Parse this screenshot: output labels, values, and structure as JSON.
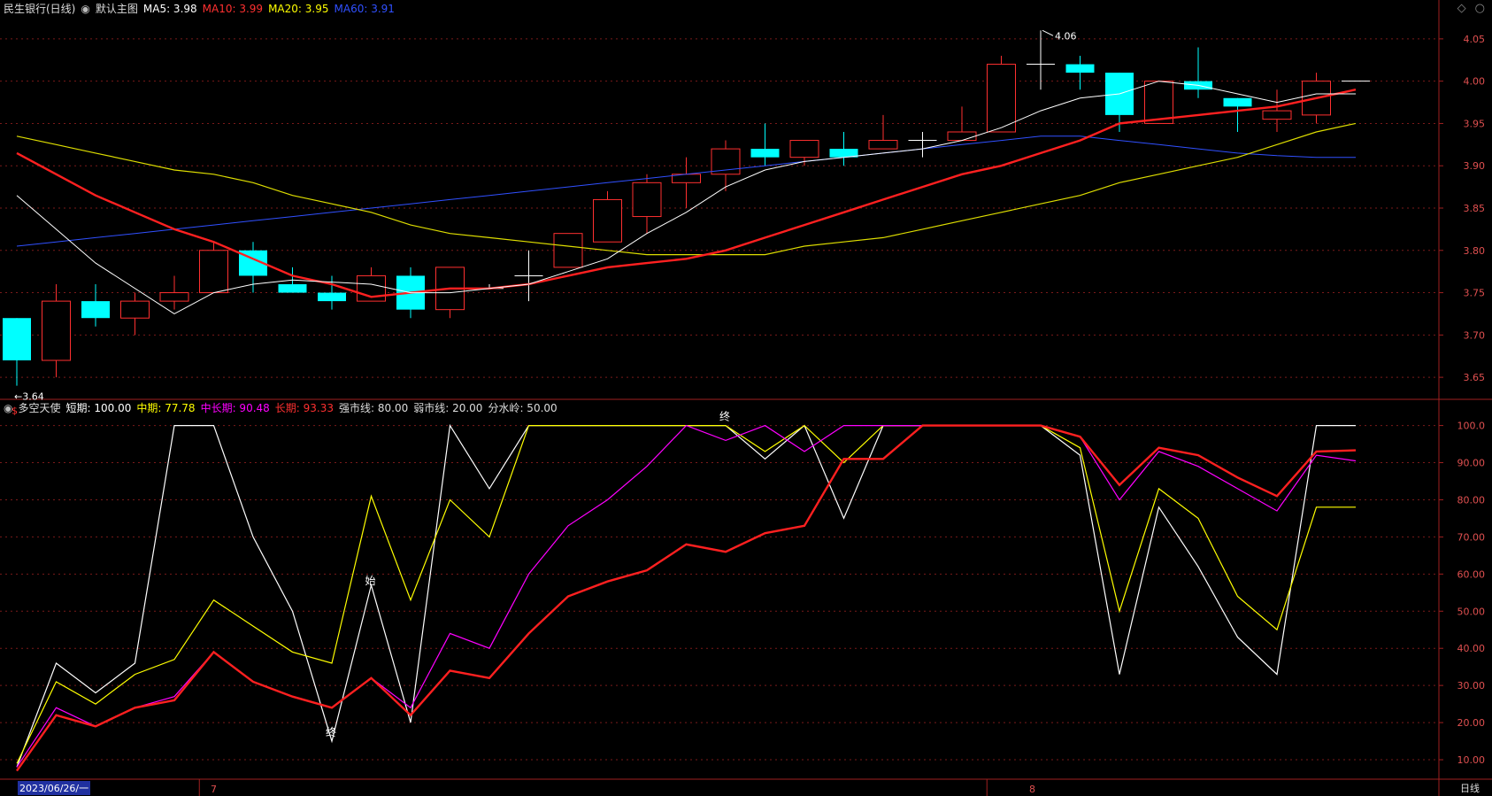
{
  "header": {
    "stock": "民生银行(日线)",
    "template": "默认主图",
    "ma": [
      {
        "label": "MA5: 3.98",
        "color": "#ffffff"
      },
      {
        "label": "MA10: 3.99",
        "color": "#ff3030"
      },
      {
        "label": "MA20: 3.95",
        "color": "#ffff00"
      },
      {
        "label": "MA60: 3.91",
        "color": "#3050ff"
      }
    ]
  },
  "indicator": {
    "name": "多空天使",
    "items": [
      {
        "label": "短期: 100.00",
        "color": "#ffffff"
      },
      {
        "label": "中期: 77.78",
        "color": "#ffff00"
      },
      {
        "label": "中长期: 90.48",
        "color": "#ff00ff"
      },
      {
        "label": "长期: 93.33",
        "color": "#ff3030"
      },
      {
        "label": "强市线: 80.00",
        "color": "#dddddd"
      },
      {
        "label": "弱市线: 20.00",
        "color": "#dddddd"
      },
      {
        "label": "分水岭: 50.00",
        "color": "#dddddd"
      }
    ]
  },
  "footer": {
    "dates": [
      "2023/06/26/一",
      "7",
      "8"
    ],
    "period": "日线"
  },
  "chart_data": [
    {
      "type": "candlestick",
      "title": "民生银行(日线)",
      "ylim": [
        3.625,
        4.075
      ],
      "yticks": [
        "4.05",
        "4.00",
        "3.95",
        "3.90",
        "3.85",
        "3.80",
        "3.75",
        "3.70",
        "3.65"
      ],
      "ohlc": [
        [
          3.72,
          3.72,
          3.64,
          3.67
        ],
        [
          3.67,
          3.76,
          3.65,
          3.74
        ],
        [
          3.74,
          3.76,
          3.71,
          3.72
        ],
        [
          3.72,
          3.75,
          3.7,
          3.74
        ],
        [
          3.74,
          3.77,
          3.73,
          3.75
        ],
        [
          3.75,
          3.81,
          3.75,
          3.8
        ],
        [
          3.8,
          3.81,
          3.75,
          3.77
        ],
        [
          3.76,
          3.78,
          3.75,
          3.75
        ],
        [
          3.75,
          3.77,
          3.73,
          3.74
        ],
        [
          3.74,
          3.78,
          3.74,
          3.77
        ],
        [
          3.77,
          3.78,
          3.72,
          3.73
        ],
        [
          3.73,
          3.78,
          3.72,
          3.78
        ],
        [
          3.755,
          3.76,
          3.755,
          3.755
        ],
        [
          3.77,
          3.8,
          3.74,
          3.77
        ],
        [
          3.78,
          3.82,
          3.78,
          3.82
        ],
        [
          3.81,
          3.87,
          3.81,
          3.86
        ],
        [
          3.84,
          3.89,
          3.82,
          3.88
        ],
        [
          3.88,
          3.91,
          3.85,
          3.89
        ],
        [
          3.89,
          3.93,
          3.87,
          3.92
        ],
        [
          3.92,
          3.95,
          3.9,
          3.91
        ],
        [
          3.91,
          3.93,
          3.9,
          3.93
        ],
        [
          3.92,
          3.94,
          3.9,
          3.91
        ],
        [
          3.92,
          3.96,
          3.92,
          3.93
        ],
        [
          3.93,
          3.94,
          3.91,
          3.93
        ],
        [
          3.93,
          3.97,
          3.93,
          3.94
        ],
        [
          3.94,
          4.03,
          3.94,
          4.02
        ],
        [
          4.02,
          4.06,
          3.99,
          4.02
        ],
        [
          4.02,
          4.03,
          3.99,
          4.01
        ],
        [
          4.01,
          4.01,
          3.94,
          3.96
        ],
        [
          3.95,
          4.0,
          3.95,
          4.0
        ],
        [
          4.0,
          4.04,
          3.98,
          3.99
        ],
        [
          3.98,
          3.98,
          3.94,
          3.97
        ],
        [
          3.955,
          3.99,
          3.94,
          3.965
        ],
        [
          3.96,
          4.01,
          3.95,
          4.0
        ],
        [
          4.0,
          4.0,
          4.0,
          4.0
        ]
      ],
      "ma5": [
        3.865,
        null,
        3.785,
        null,
        3.725,
        3.75,
        3.76,
        3.765,
        null,
        3.76,
        3.75,
        3.75,
        3.755,
        3.76,
        3.775,
        3.79,
        3.82,
        3.845,
        3.875,
        3.895,
        3.905,
        3.91,
        3.915,
        3.92,
        3.93,
        3.945,
        3.965,
        3.98,
        3.985,
        4.0,
        3.995,
        3.985,
        3.975,
        3.985,
        3.985
      ],
      "ma10": [
        3.915,
        3.89,
        3.865,
        3.845,
        3.825,
        3.81,
        3.79,
        3.77,
        3.76,
        3.745,
        3.75,
        3.755,
        3.755,
        3.76,
        3.77,
        3.78,
        3.785,
        3.79,
        3.8,
        3.815,
        3.83,
        3.845,
        3.86,
        3.875,
        3.89,
        3.9,
        3.915,
        3.93,
        3.95,
        3.955,
        3.96,
        3.965,
        3.97,
        3.98,
        3.99
      ],
      "ma20": [
        3.935,
        3.925,
        3.915,
        3.905,
        3.895,
        3.89,
        3.88,
        3.865,
        3.855,
        3.845,
        3.83,
        3.82,
        3.815,
        3.81,
        3.805,
        3.8,
        3.795,
        3.795,
        3.795,
        3.795,
        3.805,
        3.81,
        3.815,
        3.825,
        3.835,
        3.845,
        3.855,
        3.865,
        3.88,
        3.89,
        3.9,
        3.91,
        3.925,
        3.94,
        3.95
      ],
      "ma60": [
        3.805,
        3.81,
        3.815,
        3.82,
        3.825,
        3.83,
        3.835,
        3.84,
        3.845,
        3.85,
        3.855,
        3.86,
        3.865,
        3.87,
        3.875,
        3.88,
        3.885,
        3.89,
        3.895,
        3.9,
        3.905,
        3.91,
        3.915,
        3.92,
        3.925,
        3.93,
        3.935,
        3.935,
        3.93,
        3.925,
        3.92,
        3.915,
        3.912,
        3.91,
        3.91
      ],
      "annotations": [
        {
          "text": "4.06",
          "index": 26
        },
        {
          "text": "3.64",
          "index": 0
        }
      ]
    },
    {
      "type": "line",
      "title": "多空天使",
      "ylim": [
        5,
        103
      ],
      "yticks": [
        "100.0",
        "90.00",
        "80.00",
        "70.00",
        "60.00",
        "50.00",
        "40.00",
        "30.00",
        "20.00",
        "10.00"
      ],
      "series": [
        {
          "name": "短期",
          "color": "#ffffff",
          "values": [
            8,
            36,
            28,
            36,
            100,
            100,
            70,
            50,
            15,
            57,
            20,
            100,
            83,
            100,
            100,
            100,
            100,
            100,
            100,
            91,
            100,
            75,
            100,
            100,
            100,
            100,
            100,
            92,
            33,
            78,
            62,
            43,
            33,
            100,
            100
          ]
        },
        {
          "name": "中期",
          "color": "#ffff00",
          "values": [
            9,
            31,
            25,
            33,
            37,
            53,
            46,
            39,
            36,
            81,
            53,
            80,
            70,
            100,
            100,
            100,
            100,
            100,
            100,
            93,
            100,
            90,
            100,
            100,
            100,
            100,
            100,
            94,
            50,
            83,
            75,
            54,
            45,
            78,
            78
          ]
        },
        {
          "name": "中长期",
          "color": "#ff00ff",
          "values": [
            8,
            24,
            19,
            24,
            27,
            39,
            31,
            27,
            24,
            32,
            24,
            44,
            40,
            60,
            73,
            80,
            89,
            100,
            96,
            100,
            93,
            100,
            100,
            100,
            100,
            100,
            100,
            97,
            80,
            93,
            89,
            83,
            77,
            92,
            90.48
          ]
        },
        {
          "name": "长期",
          "color": "#ff2020",
          "values": [
            7,
            22,
            19,
            24,
            26,
            39,
            31,
            27,
            24,
            32,
            22,
            34,
            32,
            44,
            54,
            58,
            61,
            68,
            66,
            71,
            73,
            91,
            91,
            100,
            100,
            100,
            100,
            97,
            84,
            94,
            92,
            86,
            81,
            93,
            93.33
          ]
        }
      ],
      "annotations": [
        {
          "text": "终",
          "index": 8
        },
        {
          "text": "始",
          "index": 9
        },
        {
          "text": "终",
          "index": 18
        }
      ]
    }
  ]
}
